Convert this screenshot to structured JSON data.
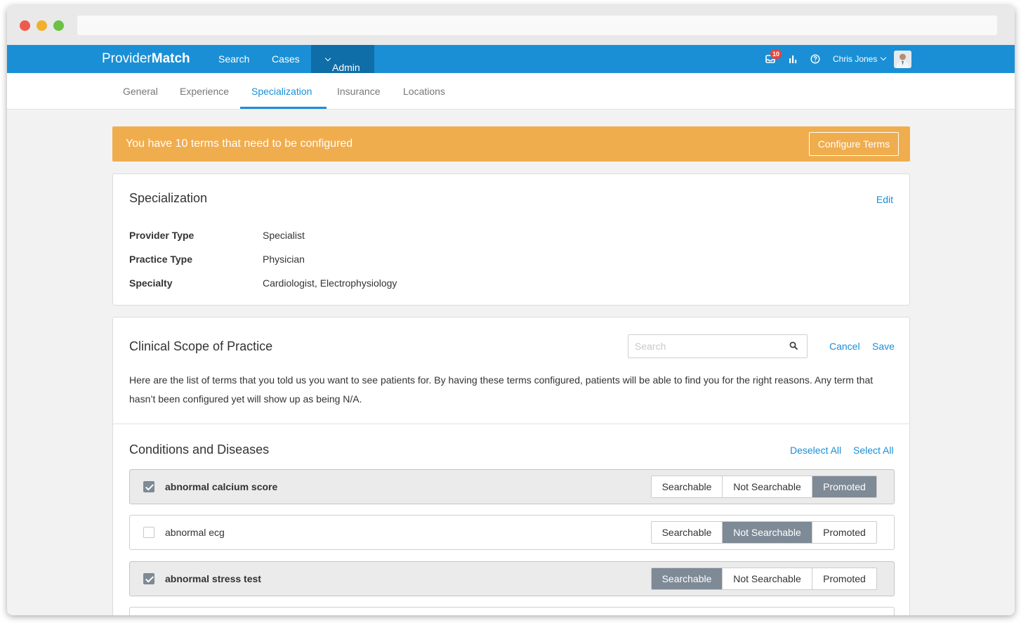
{
  "app": {
    "brand_light": "Provider",
    "brand_bold": "Match"
  },
  "topnav": {
    "items": [
      {
        "label": "Search"
      },
      {
        "label": "Cases"
      },
      {
        "label": "Admin"
      }
    ],
    "notifications_count": "10",
    "user_name": "Chris Jones",
    "icons": [
      "notifications-icon",
      "stats-icon",
      "help-icon",
      "chevron-down-icon"
    ]
  },
  "subnav": {
    "tabs": [
      {
        "label": "General"
      },
      {
        "label": "Experience"
      },
      {
        "label": "Specialization"
      },
      {
        "label": "Insurance"
      },
      {
        "label": "Locations"
      }
    ],
    "active": "Specialization"
  },
  "alert": {
    "message": "You have 10 terms that need to be configured",
    "button": "Configure Terms",
    "color": "#f0ad4e"
  },
  "specialization": {
    "title": "Specialization",
    "edit": "Edit",
    "fields": [
      {
        "label": "Provider Type",
        "value": "Specialist"
      },
      {
        "label": "Practice Type",
        "value": "Physician"
      },
      {
        "label": "Specialty",
        "value": "Cardiologist, Electrophysiology"
      }
    ]
  },
  "clinical": {
    "title": "Clinical Scope of Practice",
    "search_placeholder": "Search",
    "cancel": "Cancel",
    "save": "Save",
    "description": "Here are the list of terms that you told us you want to see patients for. By having these terms configured, patients will be able to find you for the right reasons. Any term that hasn’t been configured yet will show up as being N/A."
  },
  "conditions": {
    "title": "Conditions and Diseases",
    "deselect_all": "Deselect All",
    "select_all": "Select All",
    "options": [
      "Searchable",
      "Not Searchable",
      "Promoted"
    ],
    "terms": [
      {
        "name": "abnormal calcium score",
        "checked": true,
        "selected": "Promoted"
      },
      {
        "name": "abnormal ecg",
        "checked": false,
        "selected": "Not Searchable"
      },
      {
        "name": "abnormal stress test",
        "checked": true,
        "selected": "Searchable"
      }
    ]
  },
  "colors": {
    "primary": "#1a8fd6",
    "nav_active": "#0f6da8",
    "selected_option": "#7e8a96"
  }
}
